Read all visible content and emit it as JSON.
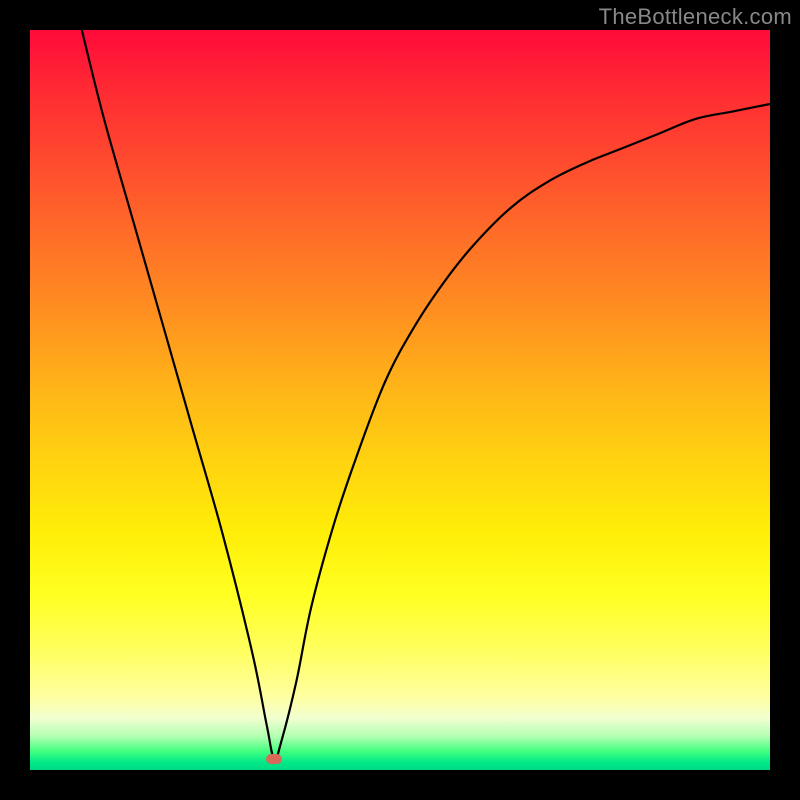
{
  "watermark": "TheBottleneck.com",
  "chart_data": {
    "type": "line",
    "title": "",
    "xlabel": "",
    "ylabel": "",
    "xlim": [
      0,
      100
    ],
    "ylim": [
      0,
      100
    ],
    "grid": false,
    "legend": false,
    "marker": {
      "x": 33,
      "y": 1.5,
      "color": "#d86a5a"
    },
    "gradient_stops": [
      {
        "pos": 0,
        "color": "#ff0a3a"
      },
      {
        "pos": 50,
        "color": "#ffb318"
      },
      {
        "pos": 76,
        "color": "#ffff20"
      },
      {
        "pos": 97,
        "color": "#40ff80"
      },
      {
        "pos": 100,
        "color": "#00d884"
      }
    ],
    "series": [
      {
        "name": "bottleneck-curve",
        "x": [
          7,
          10,
          14,
          18,
          22,
          26,
          30,
          32,
          33,
          34,
          36,
          38,
          41,
          44,
          48,
          52,
          56,
          60,
          65,
          70,
          75,
          80,
          85,
          90,
          95,
          100
        ],
        "values": [
          100,
          88,
          74,
          60,
          46,
          32,
          16,
          6,
          1.5,
          4,
          12,
          22,
          33,
          42,
          52.5,
          60,
          66,
          71,
          76,
          79.5,
          82,
          84,
          86,
          88,
          89,
          90
        ]
      }
    ]
  }
}
